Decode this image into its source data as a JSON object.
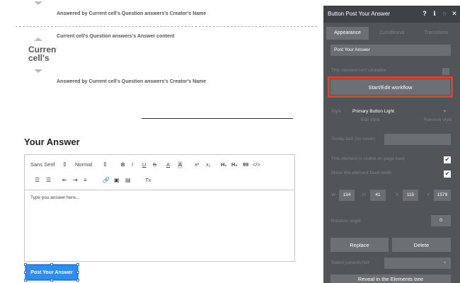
{
  "canvas": {
    "answered_by_top": "Answered by Current cell's Question answers's Creator's Name",
    "answer_content": "Current cell's Question answers's Answer content",
    "user_name_clipped": "Current cell's",
    "answered_by_bottom": "Answered by Current cell's Question answers's Creator's Name",
    "your_answer_heading": "Your Answer",
    "toolbar": {
      "font": "Sans Serif",
      "size": "Normal",
      "bold": "B",
      "italic": "I",
      "underline": "U",
      "strike": "S",
      "text_color": "A",
      "bg_color": "A",
      "superscript": "x²",
      "subscript": "x₂",
      "h1": "H₁",
      "h2": "H₂",
      "quote": "99",
      "code": "</>",
      "clear": "Tx"
    },
    "editor_placeholder": "Type you answer here...",
    "post_button_label": "Post Your Answer"
  },
  "panel": {
    "title": "Button Post Your Answer",
    "tabs": [
      "Appearance",
      "Conditional",
      "Transitions"
    ],
    "button_text_value": "Post Your Answer",
    "not_clickable_label": "This element isn't clickable",
    "workflow_button": "Start/Edit workflow",
    "style_label": "Style",
    "style_value": "Primary Button Light",
    "edit_style": "Edit style",
    "remove_style": "Remove style",
    "tooltip_label": "Tooltip text (on hover)",
    "visible_label": "This element is visible on page load",
    "fixed_width_label": "Make this element fixed-width",
    "w_label": "W",
    "w_value": "134",
    "h_label": "H",
    "h_value": "41",
    "x_label": "X",
    "x_value": "115",
    "y_label": "Y",
    "y_value": "1579",
    "rotation_label": "Rotation angle",
    "rotation_value": "0",
    "replace_button": "Replace",
    "delete_button": "Delete",
    "parent_child_label": "Select parent/child",
    "reveal_button": "Reveal in the Elements tree"
  },
  "colors": {
    "accent_blue": "#2d8ef0",
    "panel_bg": "#515559",
    "highlight_red": "#e0412f"
  }
}
